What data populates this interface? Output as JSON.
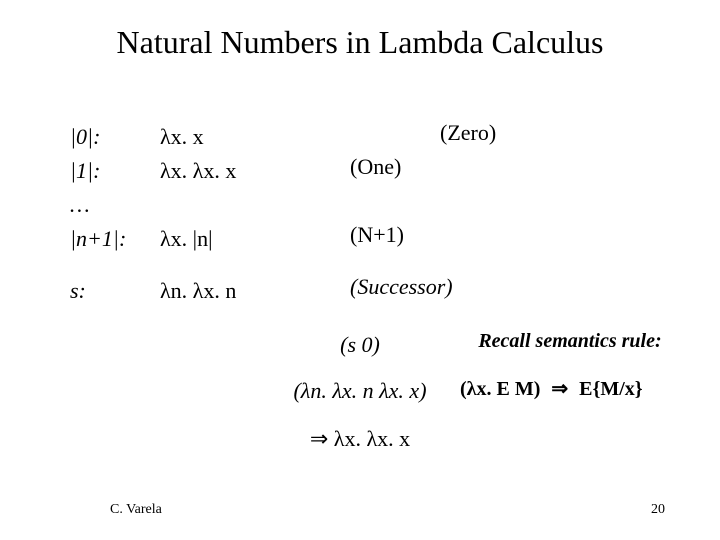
{
  "title": "Natural Numbers in Lambda Calculus",
  "rows": {
    "r0": {
      "label": "|0|:",
      "expr": "λx. x",
      "tag": "(Zero)"
    },
    "r1": {
      "label": "|1|:",
      "expr": "λx. λx. x",
      "tag": "(One)"
    },
    "dots": {
      "label": "…",
      "expr": ""
    },
    "rn": {
      "label": "|n+1|:",
      "expr": "λx. |n|",
      "tag": "(N+1)"
    },
    "s": {
      "label": "s:",
      "expr": "λn. λx. n",
      "tag": "(Successor)"
    }
  },
  "derive": {
    "d0": "(s 0)",
    "d1": "(λn. λx. n λx. x)",
    "d2": "⇒ λx. λx. x"
  },
  "recall": {
    "heading": "Recall semantics rule:",
    "rule_left": "(λx. E M)",
    "rule_arrow": "⇒",
    "rule_right": "E{M/x}"
  },
  "footer": {
    "author": "C. Varela",
    "page": "20"
  }
}
